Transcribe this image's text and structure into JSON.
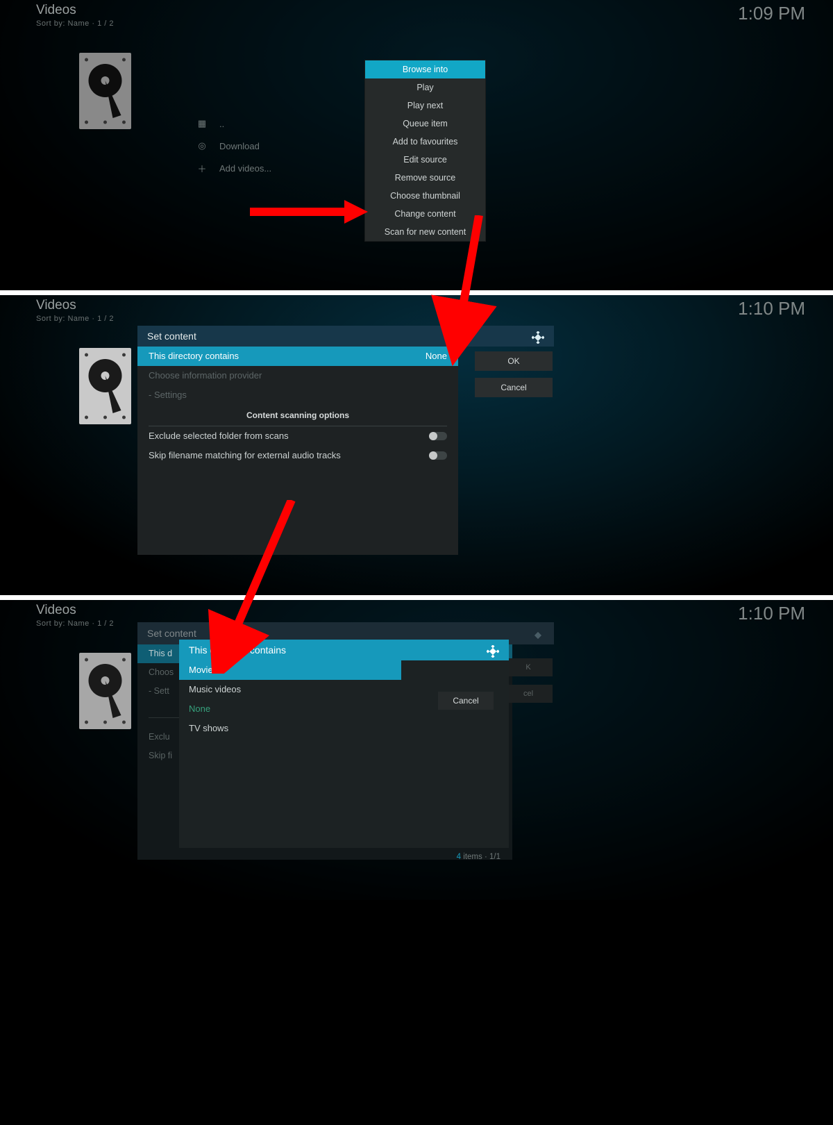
{
  "panel1": {
    "title": "Videos",
    "sort": "Sort by: Name",
    "page": "1 / 2",
    "clock": "1:09 PM",
    "sidelist": {
      "dotdot": "..",
      "download": "Download",
      "add": "Add videos..."
    },
    "context": [
      "Browse into",
      "Play",
      "Play next",
      "Queue item",
      "Add to favourites",
      "Edit source",
      "Remove source",
      "Choose thumbnail",
      "Change content",
      "Scan for new content"
    ],
    "context_selected": 0,
    "arrow_target": "Change content"
  },
  "panel2": {
    "title": "Videos",
    "sort": "Sort by: Name",
    "page": "1 / 2",
    "clock": "1:10 PM",
    "dialog": {
      "title": "Set content",
      "row_dir_label": "This directory contains",
      "row_dir_value": "None",
      "row_provider": "Choose information provider",
      "row_settings": "- Settings",
      "scan_header": "Content scanning options",
      "opt_exclude": "Exclude selected folder from scans",
      "opt_skip": "Skip filename matching for external audio tracks"
    },
    "buttons": {
      "ok": "OK",
      "cancel": "Cancel"
    }
  },
  "panel3": {
    "title": "Videos",
    "sort": "Sort by: Name",
    "page": "1 / 2",
    "clock": "1:10 PM",
    "dialog": {
      "title": "Set content",
      "row_dir_trunc": "This d",
      "row_provider_trunc": "Choos",
      "row_settings_trunc": "- Sett",
      "row_exclude_trunc": "Exclu",
      "row_skip_trunc": "Skip fi"
    },
    "chooser": {
      "title": "This directory contains",
      "items": [
        "Movies",
        "Music videos",
        "None",
        "TV shows"
      ],
      "selected": 0,
      "cancel": "Cancel",
      "footer_count": "4",
      "footer_label": "items",
      "footer_page": "1/1"
    },
    "buttons_behind": {
      "ok_trunc": "K",
      "cancel_trunc": "cel"
    }
  }
}
